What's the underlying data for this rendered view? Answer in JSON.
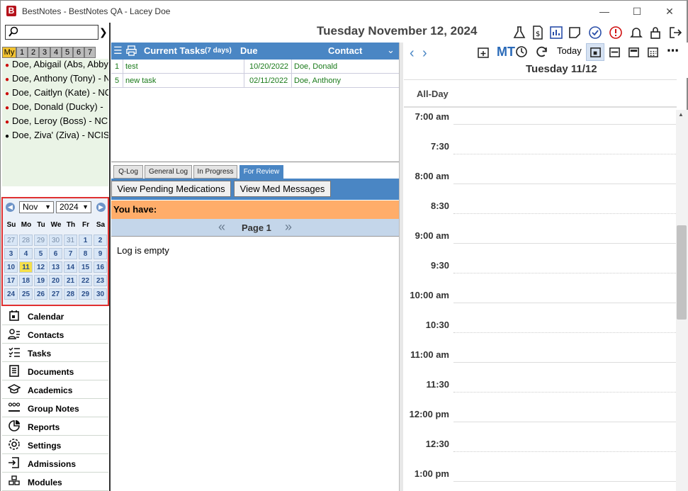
{
  "window": {
    "title": "BestNotes - BestNotes QA - Lacey Doe",
    "logo": "B",
    "controls": [
      "minimize",
      "maximize",
      "close"
    ]
  },
  "header": {
    "date": "Tuesday November 12, 2024",
    "icons": [
      "flask-icon",
      "billing-icon",
      "chart-icon",
      "note-icon",
      "check-circle-icon",
      "info-icon",
      "bell-icon",
      "lock-icon",
      "logout-icon"
    ]
  },
  "search": {
    "placeholder": "",
    "value": ""
  },
  "group_tabs": [
    "My",
    "1",
    "2",
    "3",
    "4",
    "5",
    "6",
    "7"
  ],
  "patients": [
    {
      "name": "Doe, Abigail (Abs, Abby",
      "flag": "red"
    },
    {
      "name": "Doe, Anthony (Tony) - N",
      "flag": "red"
    },
    {
      "name": "Doe, Caitlyn (Kate) - NC",
      "flag": "red"
    },
    {
      "name": "Doe, Donald (Ducky) - ",
      "flag": "red"
    },
    {
      "name": "Doe, Leroy (Boss) - NC",
      "flag": "red"
    },
    {
      "name": "Doe, Ziva' (Ziva) - NCIS",
      "flag": "black"
    }
  ],
  "mini_calendar": {
    "month": "Nov",
    "year": "2024",
    "dow": [
      "Su",
      "Mo",
      "Tu",
      "We",
      "Th",
      "Fr",
      "Sa"
    ],
    "weeks": [
      [
        "27",
        "28",
        "29",
        "30",
        "31",
        "1",
        "2"
      ],
      [
        "3",
        "4",
        "5",
        "6",
        "7",
        "8",
        "9"
      ],
      [
        "10",
        "11",
        "12",
        "13",
        "14",
        "15",
        "16"
      ],
      [
        "17",
        "18",
        "19",
        "20",
        "21",
        "22",
        "23"
      ],
      [
        "24",
        "25",
        "26",
        "27",
        "28",
        "29",
        "30"
      ]
    ],
    "today": "11"
  },
  "nav": [
    {
      "label": "Calendar",
      "icon": "calendar-icon"
    },
    {
      "label": "Contacts",
      "icon": "contacts-icon"
    },
    {
      "label": "Tasks",
      "icon": "tasks-icon"
    },
    {
      "label": "Documents",
      "icon": "documents-icon"
    },
    {
      "label": "Academics",
      "icon": "academics-icon"
    },
    {
      "label": "Group Notes",
      "icon": "group-notes-icon"
    },
    {
      "label": "Reports",
      "icon": "reports-icon"
    },
    {
      "label": "Settings",
      "icon": "settings-icon"
    },
    {
      "label": "Admissions",
      "icon": "admissions-icon"
    },
    {
      "label": "Modules",
      "icon": "modules-icon"
    }
  ],
  "tasks": {
    "title": "Current Tasks",
    "subtitle": "(7 days)",
    "col_due": "Due",
    "col_contact": "Contact",
    "rows": [
      {
        "num": "1",
        "name": "test",
        "due": "10/20/2022",
        "contact": "Doe, Donald"
      },
      {
        "num": "5",
        "name": "new task",
        "due": "02/11/2022",
        "contact": "Doe, Anthony"
      }
    ]
  },
  "log": {
    "tabs": [
      "Q-Log",
      "General Log",
      "In Progress",
      "For Review"
    ],
    "active_tab": "For Review",
    "buttons": [
      "View Pending Medications",
      "View Med Messages"
    ],
    "you_have": "You have:",
    "page_label": "Page 1",
    "empty_text": "Log is empty"
  },
  "day_view": {
    "mt_label": "MT",
    "today_label": "Today",
    "title": "Tuesday 11/12",
    "all_day": "All-Day",
    "times": [
      "7:00 am",
      "7:30",
      "8:00 am",
      "8:30",
      "9:00 am",
      "9:30",
      "10:00 am",
      "10:30",
      "11:00 am",
      "11:30",
      "12:00 pm",
      "12:30",
      "1:00 pm"
    ]
  },
  "colors": {
    "header_blue": "#4a86c4",
    "you_have_orange": "#ffad6a",
    "today_yellow": "#f6e04a",
    "selection_red": "#e03030",
    "task_green": "#1a7a1a"
  }
}
